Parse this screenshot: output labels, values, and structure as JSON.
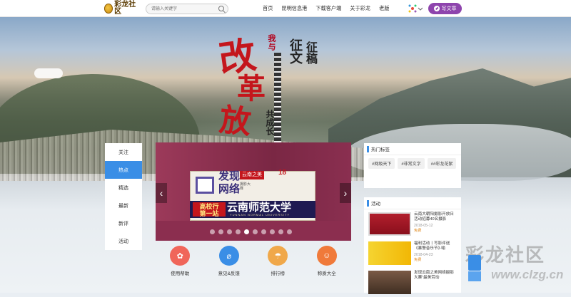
{
  "header": {
    "logo_text": "彩龙社区",
    "search_placeholder": "请输入关键字",
    "nav": [
      "首页",
      "昆明信息港",
      "下载客户端",
      "关于彩龙",
      "老版"
    ],
    "write_label": "写文章"
  },
  "banner": {
    "big1": "改",
    "big2": "革",
    "big3": "放",
    "small_red": "我与",
    "title_a": "征文",
    "title_b": "征稿",
    "grow": "共成长"
  },
  "tabs": [
    "关注",
    "热点",
    "精选",
    "最新",
    "新评",
    "活动"
  ],
  "active_tab": 1,
  "carousel": {
    "line1": "发现",
    "line2": "网络",
    "tag": "云南之美",
    "sub": "摄影大赛",
    "num": "18",
    "badge1": "高校行",
    "badge2": "第一站",
    "school": "云南师范大学",
    "school_en": "YUNNAN NORMAL UNIVERSITY",
    "dots": 10,
    "active_dot": 4
  },
  "quick": [
    {
      "label": "使用帮助",
      "color": "#f0665a"
    },
    {
      "label": "意见&反馈",
      "color": "#3a8ee6"
    },
    {
      "label": "排行榜",
      "color": "#f0a84a"
    },
    {
      "label": "称质大全",
      "color": "#f07a3a"
    }
  ],
  "hot": {
    "title": "热门标签",
    "tags": [
      "#网级天下",
      "#非常文字",
      "##彩龙花絮"
    ]
  },
  "activity": {
    "title": "活动",
    "items": [
      {
        "text": "云南大朝阳摄影开放日活动招募40名摄影",
        "date": "2018-05-12",
        "tag": "免费"
      },
      {
        "text": "福利活动丨写影评送《暴警音乐节》·喻",
        "date": "2018-04-23",
        "tag": "免费"
      },
      {
        "text": "发现云南之美网络摄影大赛“最美劳动",
        "date": "",
        "tag": ""
      }
    ]
  },
  "watermark": {
    "cn": "彩龙社区",
    "url": "www.clzg.cn"
  }
}
